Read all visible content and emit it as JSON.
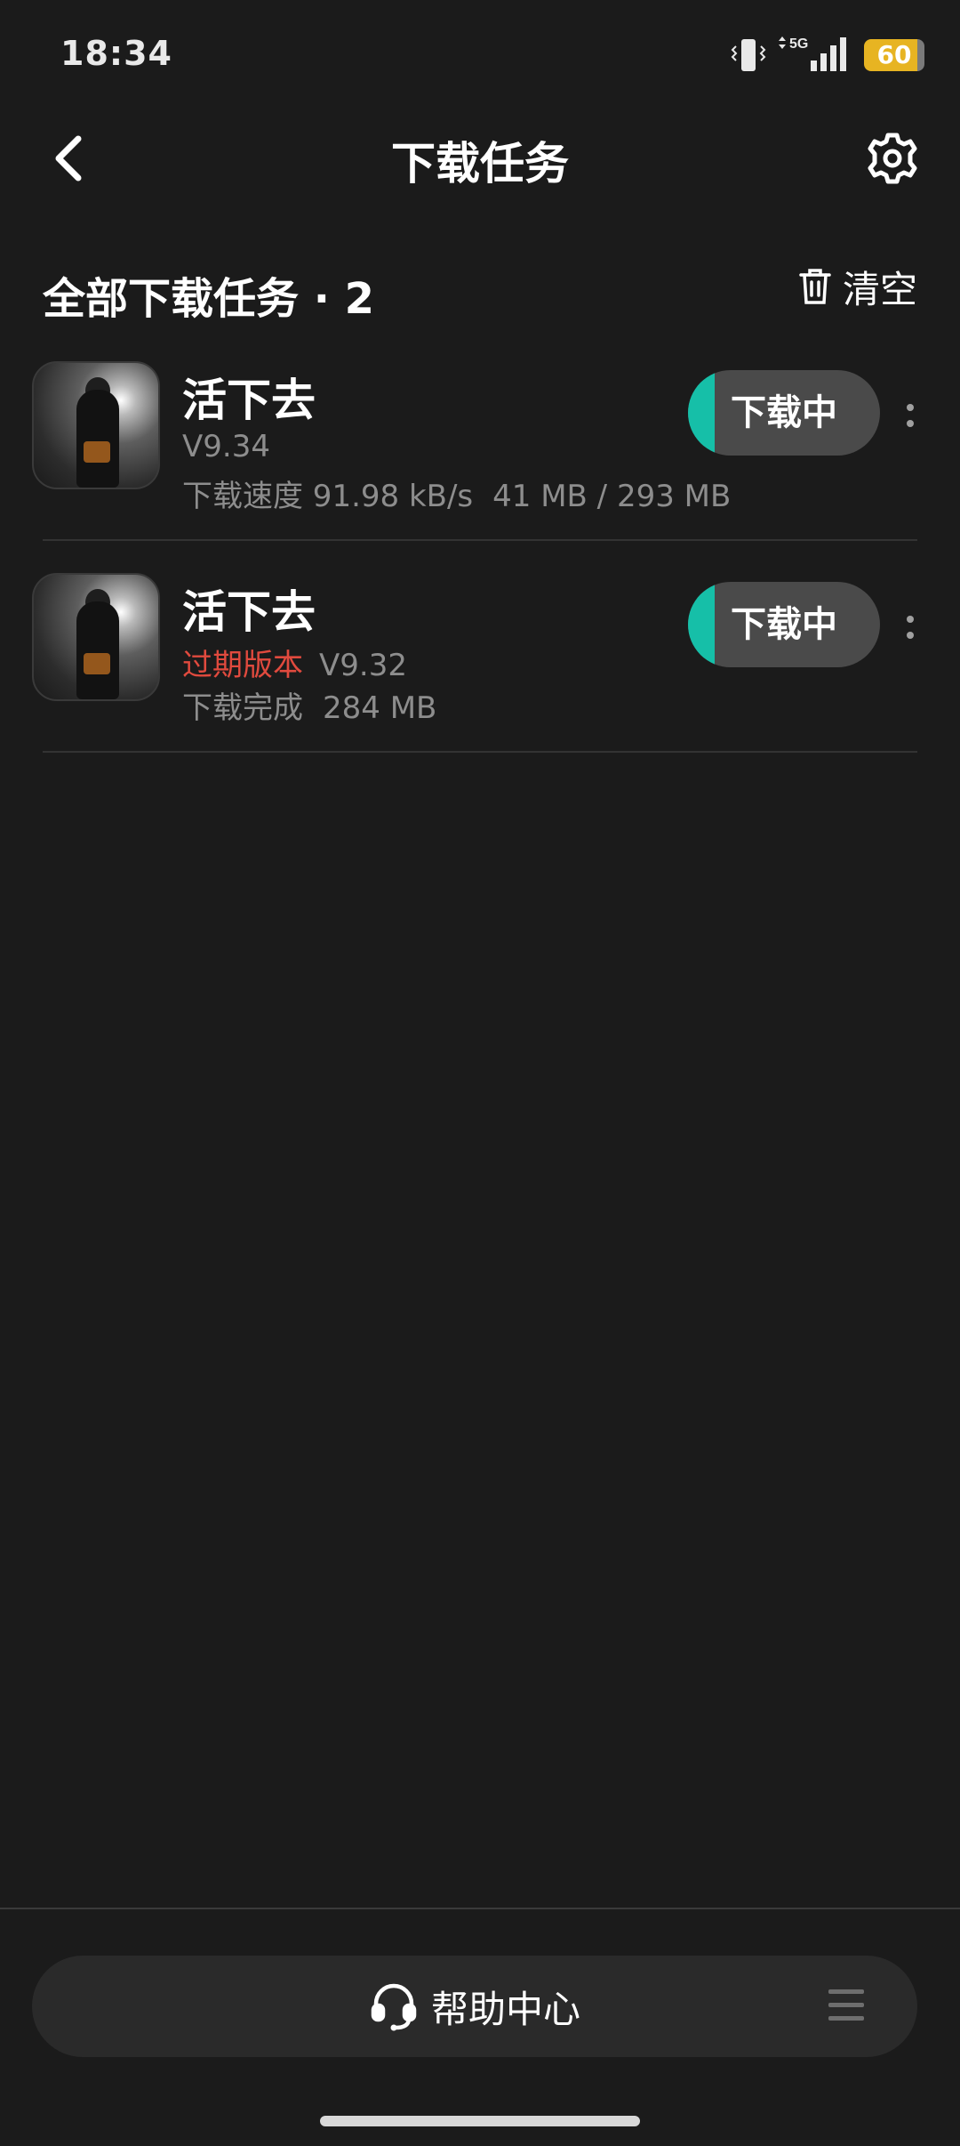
{
  "status_bar": {
    "time": "18:34",
    "battery_level": "60",
    "network": "5G",
    "colors": {
      "battery": "#e7b422"
    }
  },
  "header": {
    "title": "下载任务",
    "back_icon": "chevron-left-icon",
    "settings_icon": "gear-icon"
  },
  "section": {
    "title": "全部下载任务 · 2",
    "clear_label": "清空",
    "clear_icon": "trash-icon"
  },
  "items": [
    {
      "name": "活下去",
      "version": "V9.34",
      "status_text": "下载速度 91.98 kB/s",
      "size_text": "41 MB / 293 MB",
      "button_label": "下载中",
      "progress": 0.14
    },
    {
      "name": "活下去",
      "expired_label": "过期版本",
      "version": "V9.32",
      "status_text": "下载完成",
      "size_text": "284 MB",
      "button_label": "下载中",
      "progress": 0.14
    }
  ],
  "bottom": {
    "help_label": "帮助中心",
    "help_icon": "headset-icon",
    "menu_icon": "menu-icon"
  },
  "colors": {
    "accent": "#16bfa8",
    "expired": "#e14a3e",
    "background": "#1b1b1b"
  }
}
